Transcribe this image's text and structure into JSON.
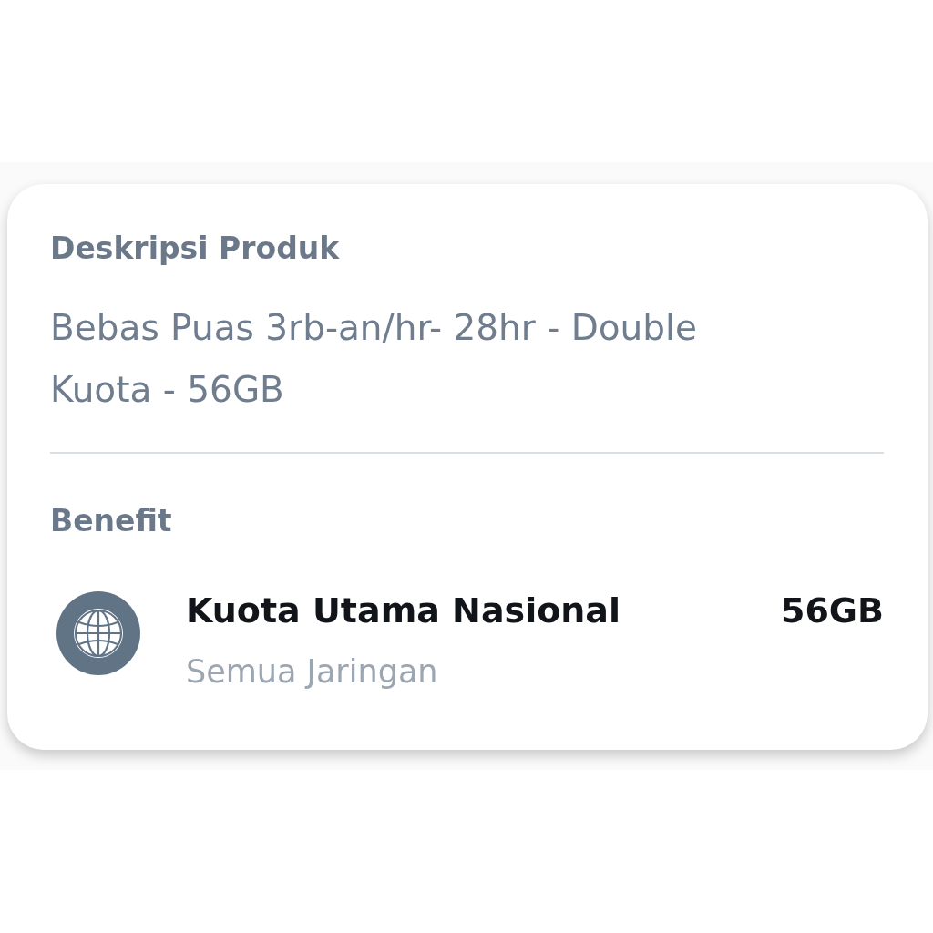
{
  "section_title": "Deskripsi Produk",
  "description": "Bebas Puas 3rb-an/hr- 28hr - Double Kuota - 56GB",
  "benefit_title": "Benefit",
  "benefits": [
    {
      "name": "Kuota Utama Nasional",
      "amount": "56GB",
      "network": "Semua Jaringan"
    }
  ]
}
